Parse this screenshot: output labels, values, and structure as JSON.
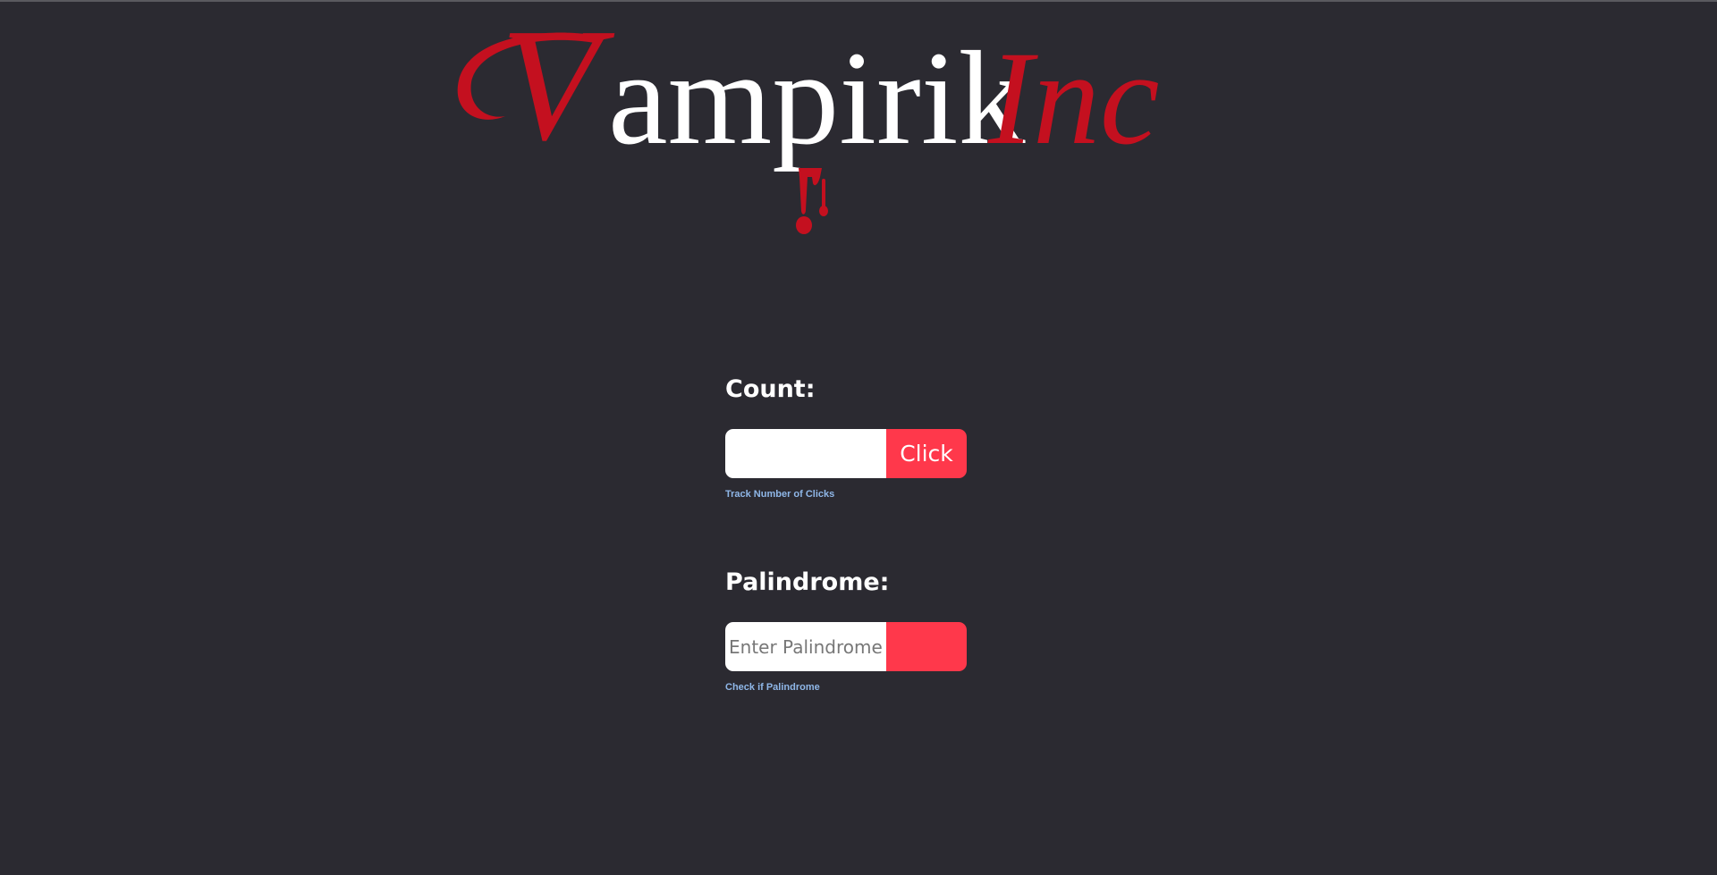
{
  "logo": {
    "initial": "V",
    "word": "ampirik",
    "suffix": "Inc",
    "colors": {
      "accent": "#c4101f",
      "text": "#ffffff"
    }
  },
  "count": {
    "title": "Count:",
    "input_value": "",
    "button_label": "Click",
    "helper": "Track Number of Clicks"
  },
  "palindrome": {
    "title": "Palindrome:",
    "input_value": "",
    "placeholder": "Enter Palindrome",
    "button_label": "",
    "helper": "Check if Palindrome"
  },
  "theme": {
    "background": "#2b2a31",
    "button": "#ff384b",
    "helper_text": "#8fb7e8"
  }
}
